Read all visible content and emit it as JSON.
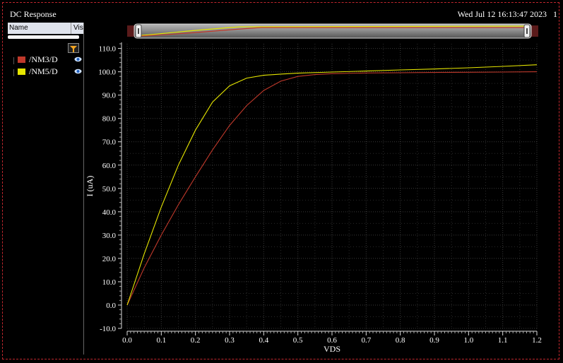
{
  "window": {
    "title": "DC Response",
    "timestamp": "Wed Jul 12 16:13:47 2023",
    "index": "1"
  },
  "signal_panel": {
    "col_name": "Name",
    "col_vis": "Vis",
    "filter_icon": "funnel-icon",
    "visibility_icon": "eye-icon",
    "items": [
      {
        "label": "/NM3/D",
        "color": "#c0392b"
      },
      {
        "label": "/NM5/D",
        "color": "#e6e600"
      }
    ]
  },
  "chart_data": {
    "type": "line",
    "xlabel": "VDS",
    "ylabel": "I (uA)",
    "xlim": [
      0.0,
      1.2
    ],
    "ylim": [
      -10.0,
      112.0
    ],
    "x_ticks": [
      "0.0",
      "0.1",
      "0.2",
      "0.3",
      "0.4",
      "0.5",
      "0.6",
      "0.7",
      "0.8",
      "0.9",
      "1.0",
      "1.1",
      "1.2"
    ],
    "y_ticks": [
      "-10.0",
      "0.0",
      "10.0",
      "20.0",
      "30.0",
      "40.0",
      "50.0",
      "60.0",
      "70.0",
      "80.0",
      "90.0",
      "100.0",
      "110.0"
    ],
    "grid": true,
    "legend": "left-panel",
    "series": [
      {
        "name": "/NM3/D",
        "color": "#c0392b",
        "x": [
          0.0,
          0.05,
          0.1,
          0.15,
          0.2,
          0.25,
          0.3,
          0.35,
          0.4,
          0.45,
          0.5,
          0.55,
          0.6,
          0.7,
          0.8,
          0.9,
          1.0,
          1.1,
          1.2
        ],
        "y": [
          0.0,
          16.0,
          30.0,
          43.0,
          55.0,
          66.5,
          77.0,
          85.5,
          92.0,
          96.0,
          98.0,
          98.8,
          99.2,
          99.5,
          99.6,
          99.7,
          99.8,
          99.9,
          100.0
        ]
      },
      {
        "name": "/NM5/D",
        "color": "#e6e600",
        "x": [
          0.0,
          0.05,
          0.1,
          0.15,
          0.2,
          0.25,
          0.3,
          0.35,
          0.4,
          0.45,
          0.5,
          0.6,
          0.7,
          0.8,
          0.9,
          1.0,
          1.1,
          1.2
        ],
        "y": [
          0.0,
          22.0,
          42.0,
          60.0,
          75.0,
          87.0,
          94.0,
          97.3,
          98.5,
          99.0,
          99.4,
          99.9,
          100.3,
          100.8,
          101.2,
          101.7,
          102.3,
          103.0
        ]
      }
    ]
  }
}
